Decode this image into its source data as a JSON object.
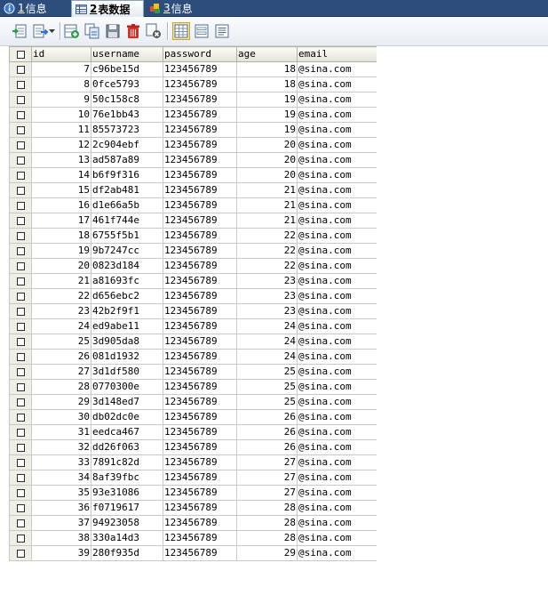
{
  "tabs": [
    {
      "num": "1",
      "label": " 信息",
      "active": false
    },
    {
      "num": "2",
      "label": " 表数据",
      "active": true
    },
    {
      "num": "3",
      "label": " 信息",
      "active": false
    }
  ],
  "toolbar": {
    "icons": [
      "import-icon",
      "export-icon",
      "add-row-icon",
      "duplicate-row-icon",
      "save-icon",
      "delete-icon",
      "cancel-icon",
      "grid-view-icon",
      "form-view-icon",
      "text-view-icon"
    ]
  },
  "table": {
    "columns": [
      "id",
      "username",
      "password",
      "age",
      "email"
    ],
    "rows": [
      [
        "7",
        "c96be15d",
        "123456789",
        "18",
        "@sina.com"
      ],
      [
        "8",
        "0fce5793",
        "123456789",
        "18",
        "@sina.com"
      ],
      [
        "9",
        "50c158c8",
        "123456789",
        "19",
        "@sina.com"
      ],
      [
        "10",
        "76e1bb43",
        "123456789",
        "19",
        "@sina.com"
      ],
      [
        "11",
        "85573723",
        "123456789",
        "19",
        "@sina.com"
      ],
      [
        "12",
        "2c904ebf",
        "123456789",
        "20",
        "@sina.com"
      ],
      [
        "13",
        "ad587a89",
        "123456789",
        "20",
        "@sina.com"
      ],
      [
        "14",
        "b6f9f316",
        "123456789",
        "20",
        "@sina.com"
      ],
      [
        "15",
        "df2ab481",
        "123456789",
        "21",
        "@sina.com"
      ],
      [
        "16",
        "d1e66a5b",
        "123456789",
        "21",
        "@sina.com"
      ],
      [
        "17",
        "461f744e",
        "123456789",
        "21",
        "@sina.com"
      ],
      [
        "18",
        "6755f5b1",
        "123456789",
        "22",
        "@sina.com"
      ],
      [
        "19",
        "9b7247cc",
        "123456789",
        "22",
        "@sina.com"
      ],
      [
        "20",
        "0823d184",
        "123456789",
        "22",
        "@sina.com"
      ],
      [
        "21",
        "a81693fc",
        "123456789",
        "23",
        "@sina.com"
      ],
      [
        "22",
        "d656ebc2",
        "123456789",
        "23",
        "@sina.com"
      ],
      [
        "23",
        "42b2f9f1",
        "123456789",
        "23",
        "@sina.com"
      ],
      [
        "24",
        "ed9abe11",
        "123456789",
        "24",
        "@sina.com"
      ],
      [
        "25",
        "3d905da8",
        "123456789",
        "24",
        "@sina.com"
      ],
      [
        "26",
        "081d1932",
        "123456789",
        "24",
        "@sina.com"
      ],
      [
        "27",
        "3d1df580",
        "123456789",
        "25",
        "@sina.com"
      ],
      [
        "28",
        "0770300e",
        "123456789",
        "25",
        "@sina.com"
      ],
      [
        "29",
        "3d148ed7",
        "123456789",
        "25",
        "@sina.com"
      ],
      [
        "30",
        "db02dc0e",
        "123456789",
        "26",
        "@sina.com"
      ],
      [
        "31",
        "eedca467",
        "123456789",
        "26",
        "@sina.com"
      ],
      [
        "32",
        "dd26f063",
        "123456789",
        "26",
        "@sina.com"
      ],
      [
        "33",
        "7891c82d",
        "123456789",
        "27",
        "@sina.com"
      ],
      [
        "34",
        "8af39fbc",
        "123456789",
        "27",
        "@sina.com"
      ],
      [
        "35",
        "93e31086",
        "123456789",
        "27",
        "@sina.com"
      ],
      [
        "36",
        "f0719617",
        "123456789",
        "28",
        "@sina.com"
      ],
      [
        "37",
        "94923058",
        "123456789",
        "28",
        "@sina.com"
      ],
      [
        "38",
        "330a14d3",
        "123456789",
        "28",
        "@sina.com"
      ],
      [
        "39",
        "280f935d",
        "123456789",
        "29",
        "@sina.com"
      ]
    ]
  },
  "colors": {
    "tabbar_bg": "#2d4e7c",
    "header_bg": "#e4e2d8",
    "grid_line": "#c9c9c9"
  }
}
